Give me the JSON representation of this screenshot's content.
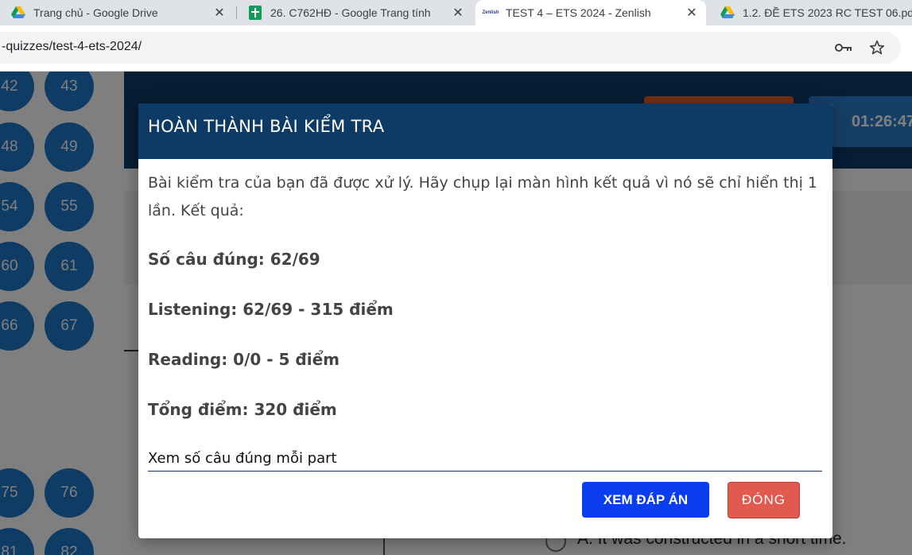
{
  "browser": {
    "tabs": [
      {
        "title": "Trang chủ - Google Drive",
        "icon": "google-drive-icon"
      },
      {
        "title": "26. C762HĐ - Google Trang tính",
        "icon": "google-sheets-icon"
      },
      {
        "title": "TEST 4 – ETS 2024 - Zenlish",
        "icon": "zenlish-icon",
        "favicon_text": "Zenlish"
      },
      {
        "title": "1.2. ĐỀ ETS 2023 RC TEST 06.pdf",
        "icon": "google-drive-icon"
      }
    ],
    "close_glyph": "✕",
    "url": "-quizzes/test-4-ets-2024/"
  },
  "page": {
    "question_numbers": [
      "42",
      "43",
      "48",
      "49",
      "54",
      "55",
      "60",
      "61",
      "66",
      "67",
      "75",
      "76",
      "81",
      "82"
    ],
    "timer": "01:26:47",
    "option_a": "A. It was constructed in a short time."
  },
  "modal": {
    "title": "HOÀN THÀNH BÀI KIỂM TRA",
    "message": "Bài kiểm tra của bạn đã được xử lý. Hãy chụp lại màn hình kết quả vì nó sẽ chỉ hiển thị 1 lần. Kết quả:",
    "results": {
      "correct": "Số câu đúng: 62/69",
      "listening": "Listening: 62/69 - 315 điểm",
      "reading": "Reading: 0/0 - 5 điểm",
      "total": "Tổng điểm: 320 điểm"
    },
    "part_link": "Xem số câu đúng mỗi part",
    "view_answers_button": "XEM ĐÁP ÁN",
    "close_button": "ĐÓNG"
  },
  "colors": {
    "header_navy": "#0d3b66",
    "primary_blue": "#0a3cf0",
    "close_red": "#e05a4f",
    "question_circle": "#1f78c8"
  }
}
